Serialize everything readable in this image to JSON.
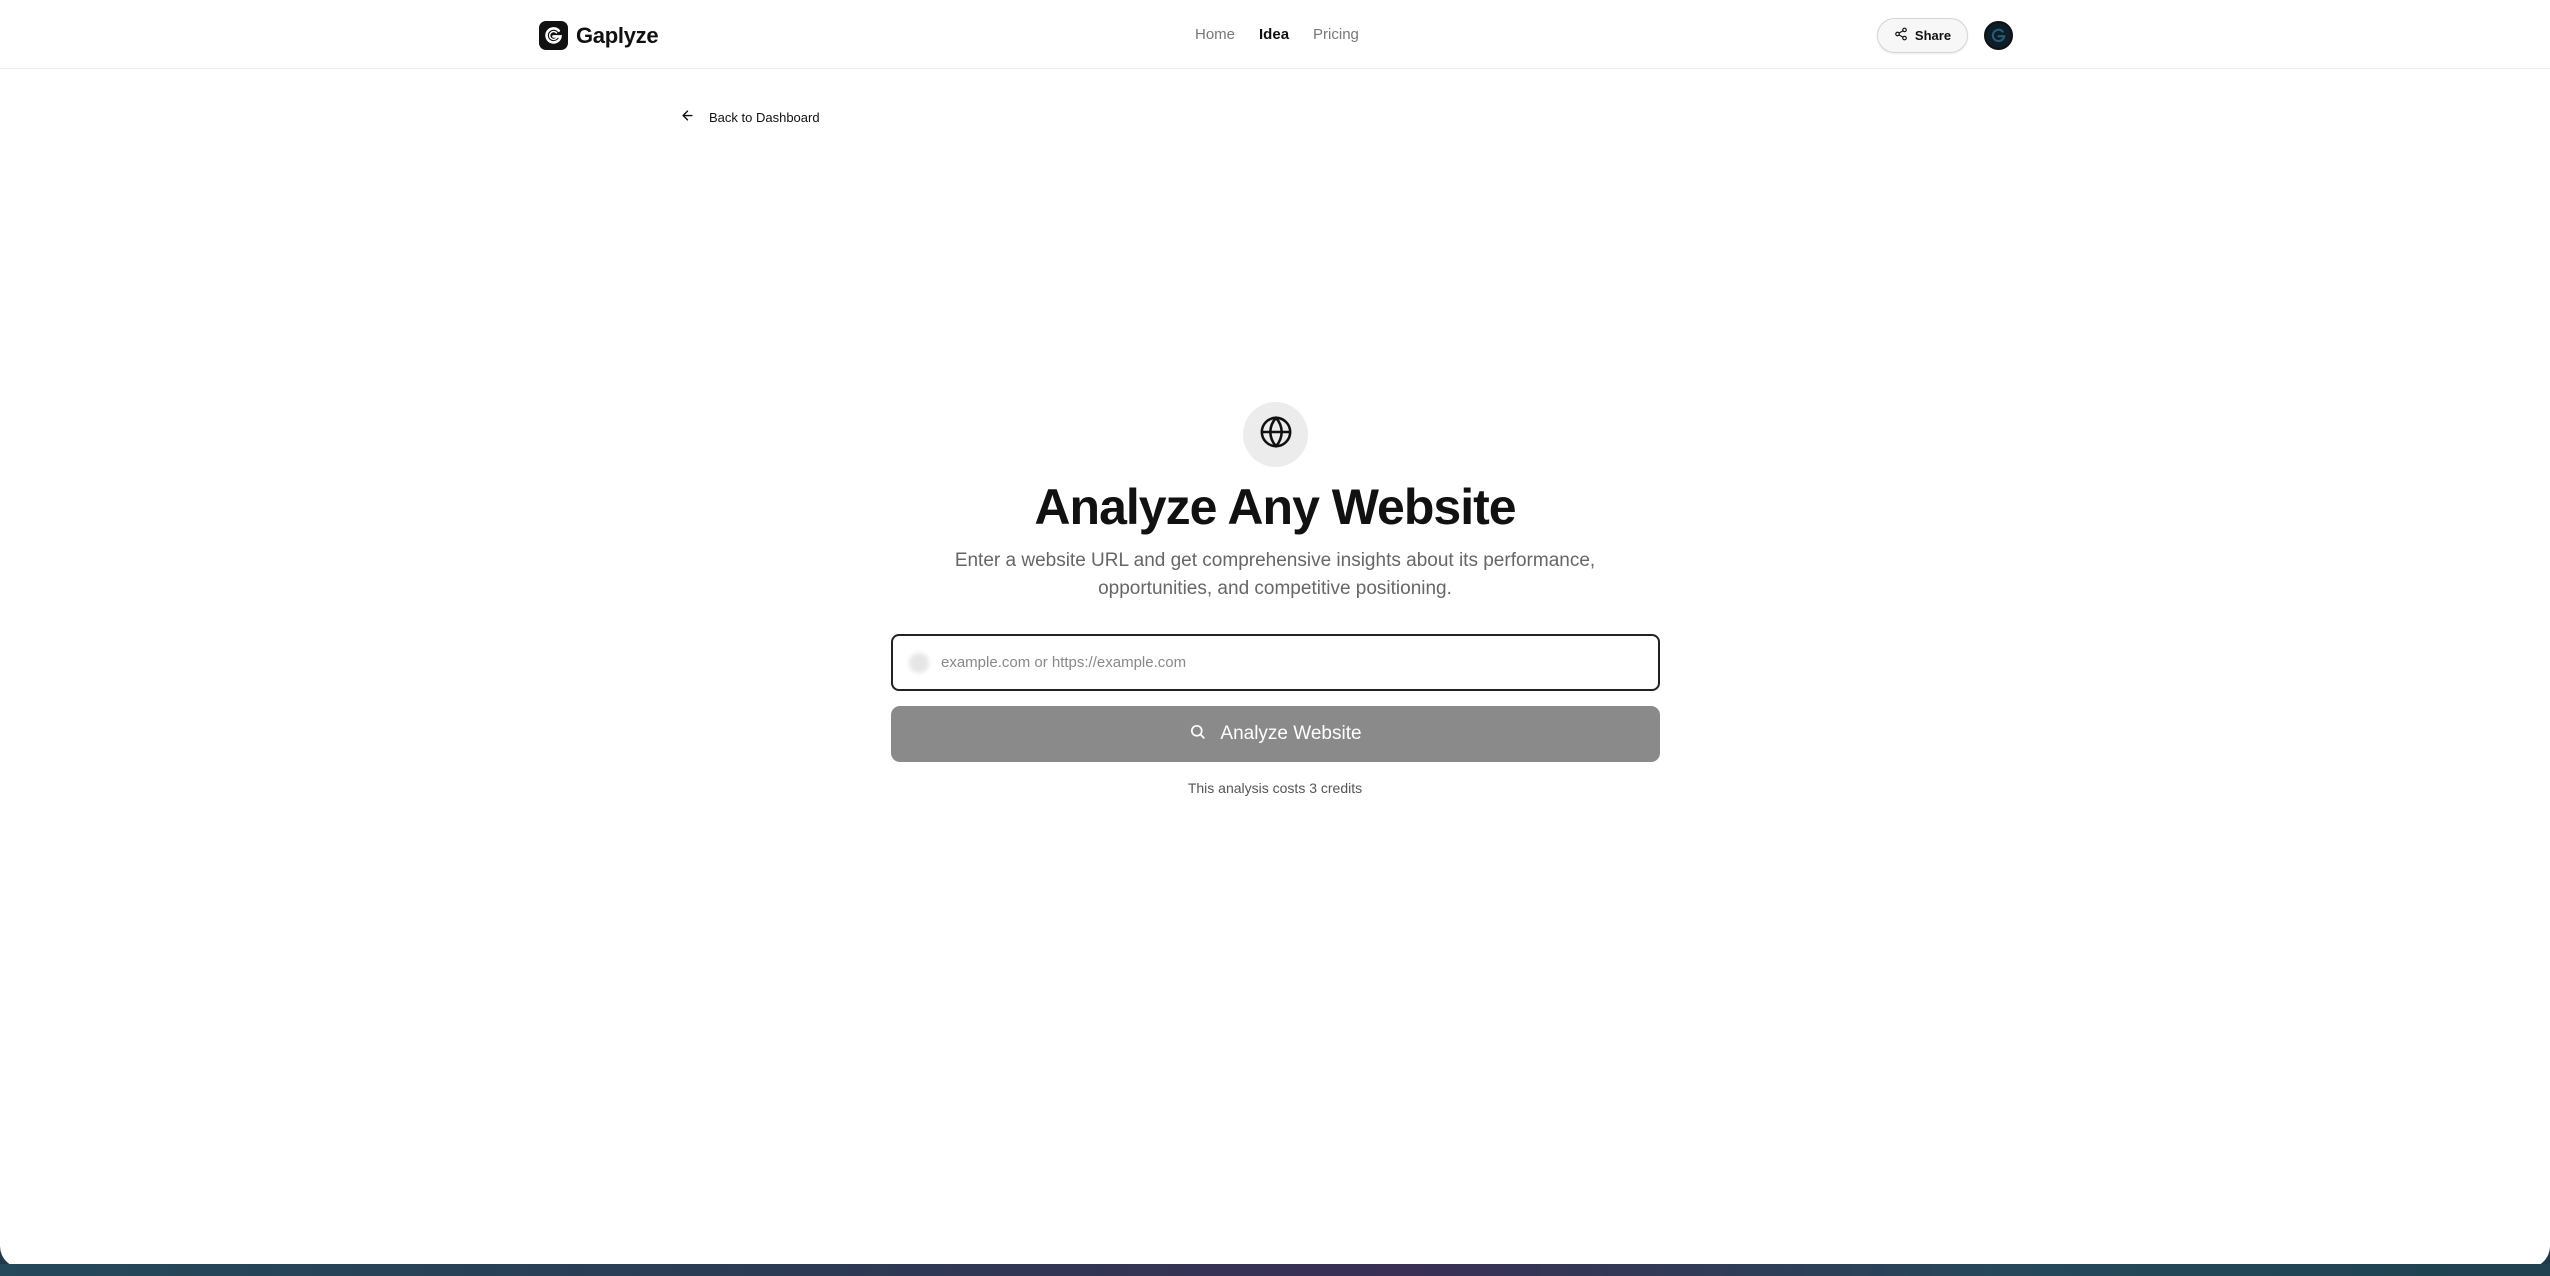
{
  "header": {
    "brand": "Gaplyze",
    "nav": [
      {
        "label": "Home",
        "active": false
      },
      {
        "label": "Idea",
        "active": true
      },
      {
        "label": "Pricing",
        "active": false
      }
    ],
    "share_label": "Share",
    "logo_icon": "gaplyze-logo-icon",
    "share_icon": "share-icon",
    "avatar_icon": "user-avatar"
  },
  "back_link": {
    "label": "Back to Dashboard",
    "icon": "arrow-left-icon"
  },
  "hero": {
    "icon": "globe-icon",
    "title": "Analyze Any Website",
    "subtitle": "Enter a website URL and get comprehensive insights about its performance, opportunities, and competitive positioning."
  },
  "form": {
    "url_placeholder": "example.com or https://example.com",
    "url_value": "",
    "submit_label": "Analyze Website",
    "submit_icon": "search-icon",
    "cost_note": "This analysis costs 3 credits"
  },
  "colors": {
    "text_primary": "#111111",
    "text_muted": "#666666",
    "button_disabled": "#8a8a8a",
    "globe_bg": "#ececec"
  }
}
